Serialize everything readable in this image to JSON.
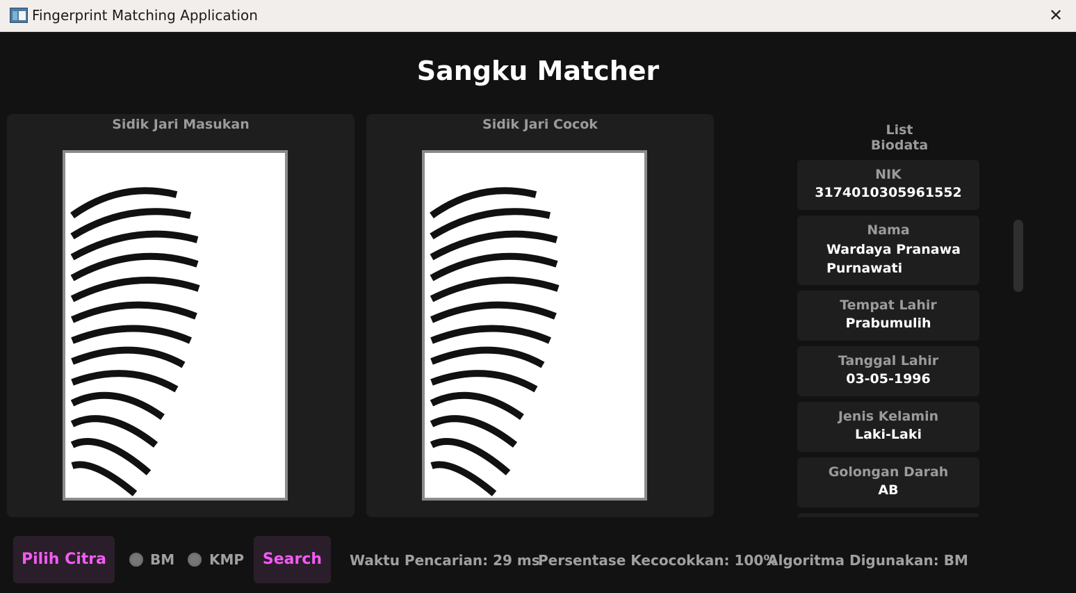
{
  "window": {
    "title": "Fingerprint Matching Application",
    "close_glyph": "✕"
  },
  "app": {
    "title": "Sangku Matcher"
  },
  "panels": {
    "input_title": "Sidik Jari Masukan",
    "match_title": "Sidik Jari Cocok"
  },
  "biodata": {
    "title": "List Biodata",
    "items": [
      {
        "label": "NIK",
        "value": "3174010305961552"
      },
      {
        "label": "Nama",
        "value_line1": "Wardaya Pranawa",
        "value_line2": "Purnawati"
      },
      {
        "label": "Tempat Lahir",
        "value": "Prabumulih"
      },
      {
        "label": "Tanggal Lahir",
        "value": "03-05-1996"
      },
      {
        "label": "Jenis Kelamin",
        "value": "Laki-Laki"
      },
      {
        "label": "Golongan Darah",
        "value": "AB"
      }
    ]
  },
  "controls": {
    "pick_image_label": "Pilih Citra",
    "algorithm_options": [
      "BM",
      "KMP"
    ],
    "search_label": "Search"
  },
  "status": {
    "search_time": "Waktu Pencarian: 29 ms",
    "match_percentage": "Persentase Kecocokkan: 100%",
    "algorithm_used": "Algoritma Digunakan: BM"
  },
  "colors": {
    "background": "#121212",
    "panel": "#1e1e1e",
    "accent": "#f35bf3",
    "button_bg": "#2b1e2b"
  }
}
